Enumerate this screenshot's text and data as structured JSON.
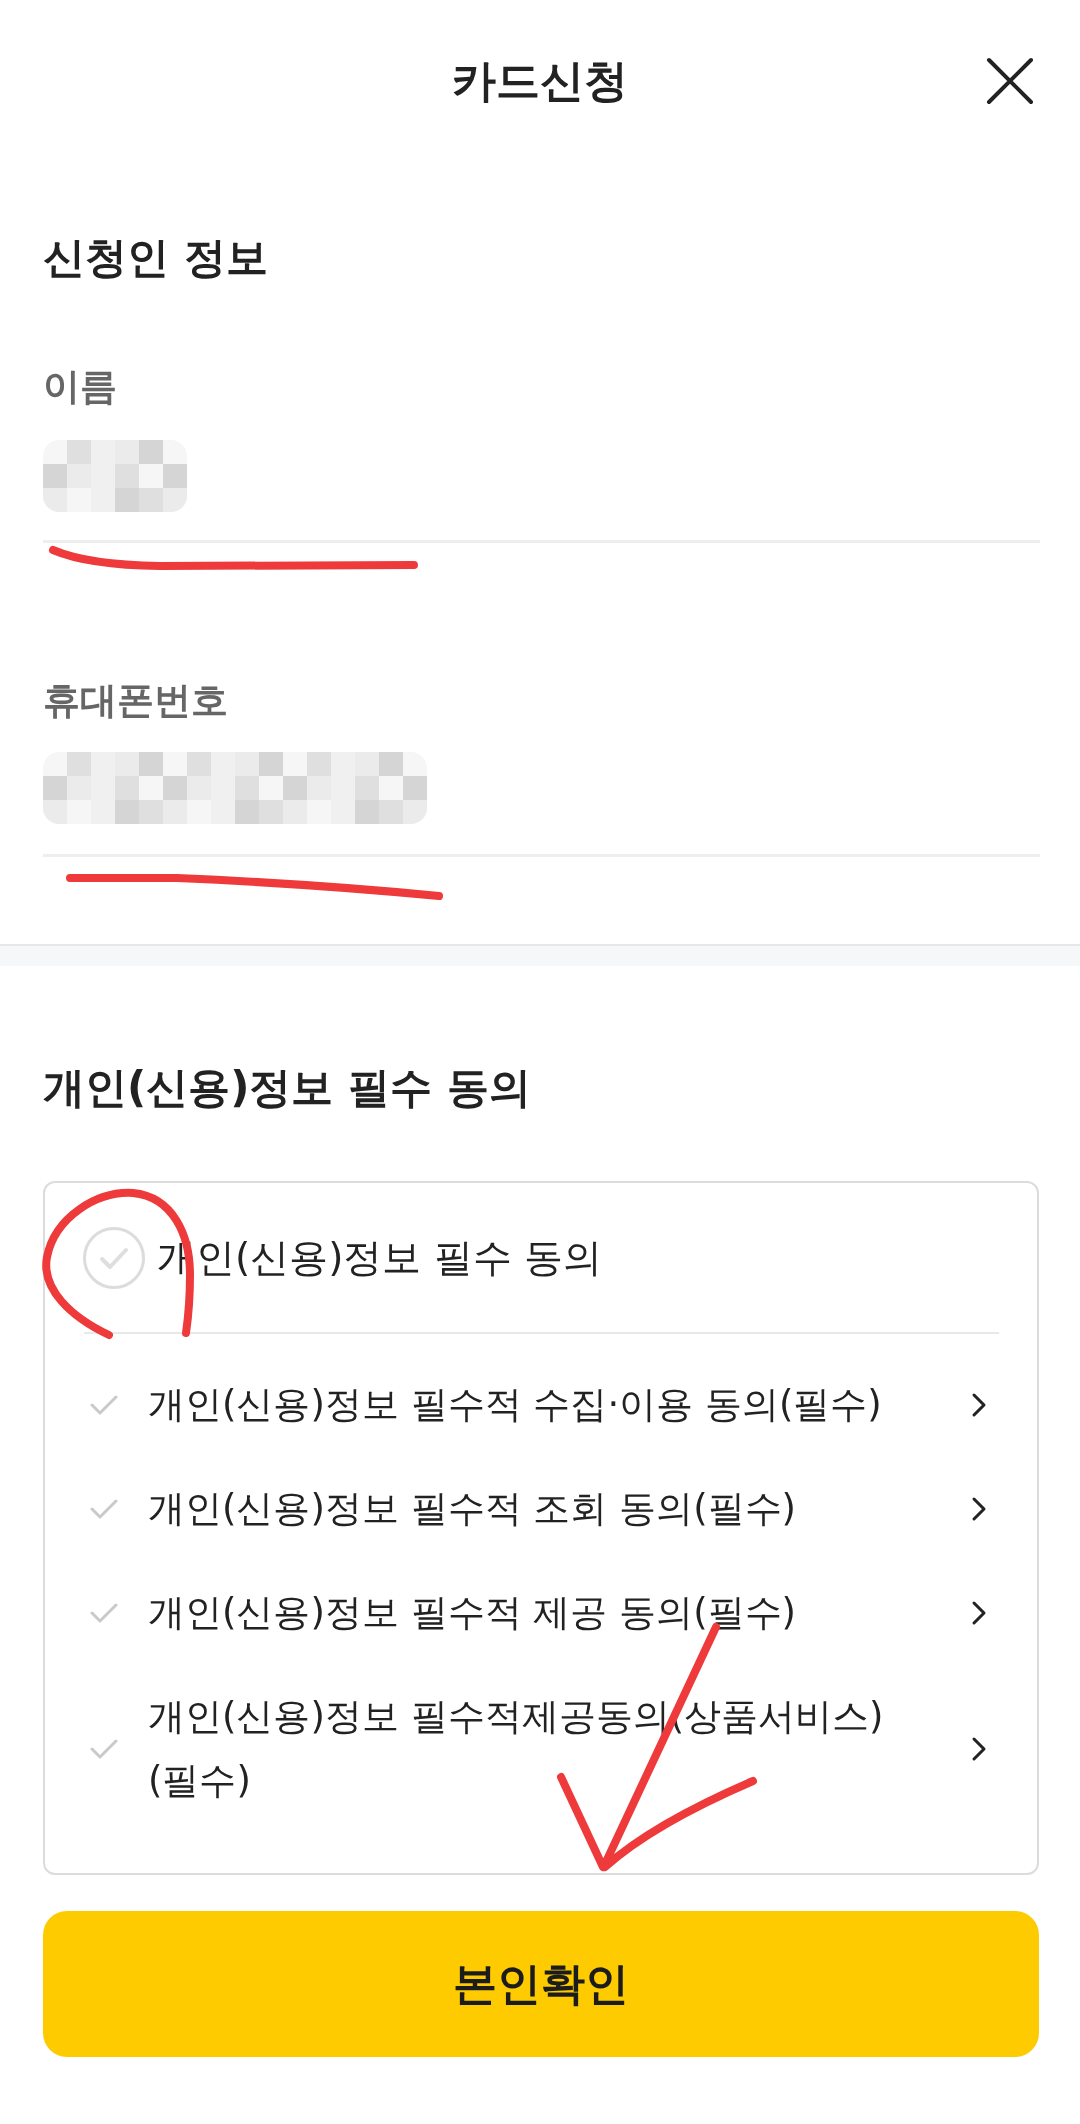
{
  "header": {
    "title": "카드신청"
  },
  "applicant": {
    "title": "신청인 정보",
    "fields": [
      {
        "kind": "name",
        "label": "이름",
        "value_obscured": true,
        "hand_underlined": true
      },
      {
        "kind": "phone",
        "label": "휴대폰번호",
        "value_obscured": true,
        "hand_underlined": true
      }
    ]
  },
  "consent": {
    "title": "개인(신용)정보 필수 동의",
    "all_agree": {
      "label": "개인(신용)정보 필수 동의",
      "checked": false,
      "hand_circled": true
    },
    "items": [
      {
        "label": "개인(신용)정보 필수적 수집·이용 동의(필수)",
        "checked": false
      },
      {
        "label": "개인(신용)정보 필수적 조회 동의(필수)",
        "checked": false
      },
      {
        "label": "개인(신용)정보 필수적 제공 동의(필수)",
        "checked": false
      },
      {
        "label": "개인(신용)정보 필수적제공동의(상품서비스)(필수)",
        "checked": false
      }
    ]
  },
  "confirm_button": {
    "label": "본인확인",
    "hand_arrow": true
  }
}
